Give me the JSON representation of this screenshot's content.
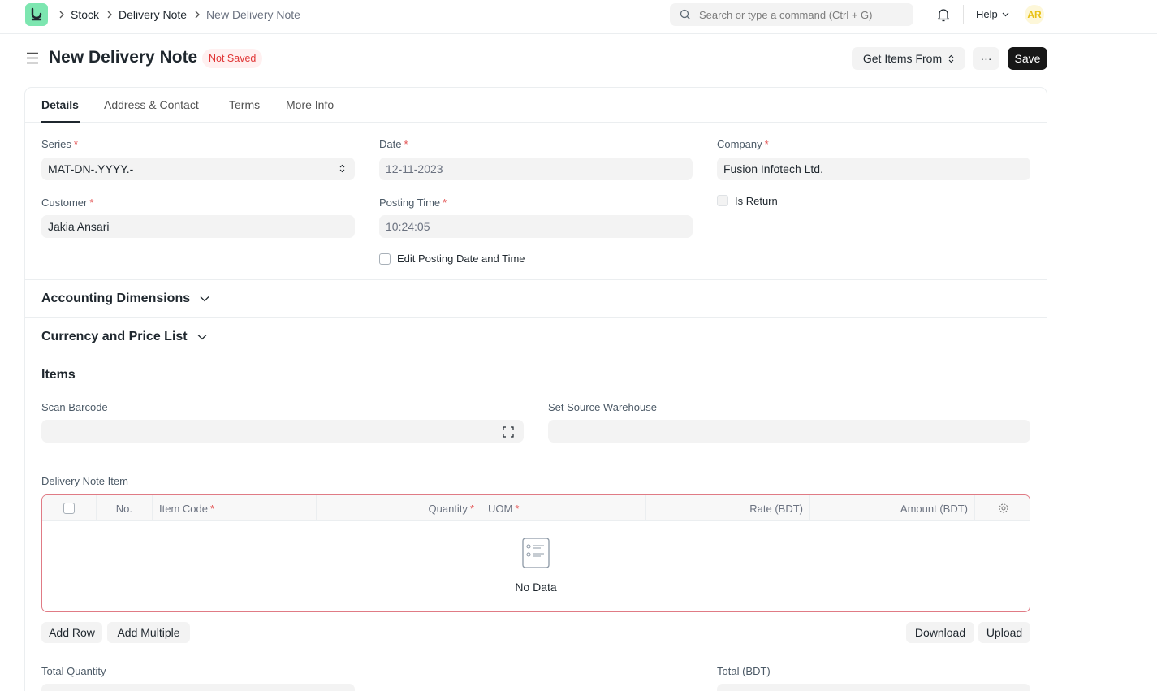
{
  "navbar": {
    "breadcrumbs": [
      "Stock",
      "Delivery Note",
      "New Delivery Note"
    ],
    "search_placeholder": "Search or type a command (Ctrl + G)",
    "help_label": "Help",
    "avatar_initials": "AR"
  },
  "page": {
    "title": "New Delivery Note",
    "status": "Not Saved",
    "get_items_label": "Get Items From",
    "more_label": "···",
    "save_label": "Save"
  },
  "tabs": [
    "Details",
    "Address & Contact",
    "Terms",
    "More Info"
  ],
  "form": {
    "series": {
      "label": "Series",
      "value": "MAT-DN-.YYYY.-"
    },
    "date": {
      "label": "Date",
      "value": "12-11-2023"
    },
    "company": {
      "label": "Company",
      "value": "Fusion Infotech Ltd."
    },
    "customer": {
      "label": "Customer",
      "value": "Jakia Ansari"
    },
    "posting_time": {
      "label": "Posting Time",
      "value": "10:24:05"
    },
    "is_return_label": "Is Return",
    "edit_posting_label": "Edit Posting Date and Time"
  },
  "sections": {
    "accounting": "Accounting Dimensions",
    "currency": "Currency and Price List",
    "items": "Items"
  },
  "items": {
    "scan_barcode_label": "Scan Barcode",
    "source_warehouse_label": "Set Source Warehouse",
    "grid_label": "Delivery Note Item",
    "columns": {
      "no": "No.",
      "item_code": "Item Code",
      "quantity": "Quantity",
      "uom": "UOM",
      "rate": "Rate (BDT)",
      "amount": "Amount (BDT)"
    },
    "no_data": "No Data",
    "add_row": "Add Row",
    "add_multiple": "Add Multiple",
    "download": "Download",
    "upload": "Upload"
  },
  "totals": {
    "total_quantity_label": "Total Quantity",
    "total_label": "Total (BDT)"
  },
  "colors": {
    "accent_dark": "#171717",
    "status_red": "#e03636",
    "logo_green": "#7de6b0",
    "grid_border_error": "#e07b85"
  }
}
